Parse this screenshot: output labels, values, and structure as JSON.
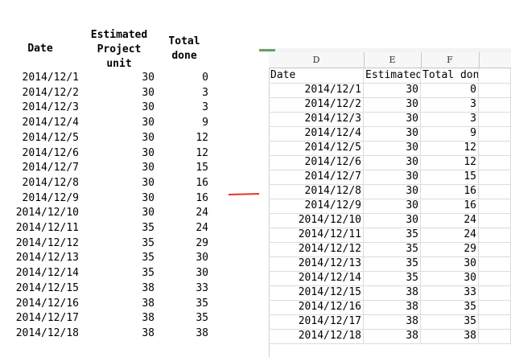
{
  "left_table": {
    "headers": {
      "date": "Date",
      "estimated": "Estimated\nProject\nunit",
      "total": "Total\ndone"
    },
    "rows": [
      {
        "date": "2014/12/1",
        "estimated": "30",
        "total": "0"
      },
      {
        "date": "2014/12/2",
        "estimated": "30",
        "total": "3"
      },
      {
        "date": "2014/12/3",
        "estimated": "30",
        "total": "3"
      },
      {
        "date": "2014/12/4",
        "estimated": "30",
        "total": "9"
      },
      {
        "date": "2014/12/5",
        "estimated": "30",
        "total": "12"
      },
      {
        "date": "2014/12/6",
        "estimated": "30",
        "total": "12"
      },
      {
        "date": "2014/12/7",
        "estimated": "30",
        "total": "15"
      },
      {
        "date": "2014/12/8",
        "estimated": "30",
        "total": "16"
      },
      {
        "date": "2014/12/9",
        "estimated": "30",
        "total": "16"
      },
      {
        "date": "2014/12/10",
        "estimated": "30",
        "total": "24"
      },
      {
        "date": "2014/12/11",
        "estimated": "35",
        "total": "24"
      },
      {
        "date": "2014/12/12",
        "estimated": "35",
        "total": "29"
      },
      {
        "date": "2014/12/13",
        "estimated": "35",
        "total": "30"
      },
      {
        "date": "2014/12/14",
        "estimated": "35",
        "total": "30"
      },
      {
        "date": "2014/12/15",
        "estimated": "38",
        "total": "33"
      },
      {
        "date": "2014/12/16",
        "estimated": "38",
        "total": "35"
      },
      {
        "date": "2014/12/17",
        "estimated": "38",
        "total": "35"
      },
      {
        "date": "2014/12/18",
        "estimated": "38",
        "total": "38"
      }
    ]
  },
  "arrow": {
    "icon": "right-arrow-icon",
    "color": "#e8312a"
  },
  "spreadsheet": {
    "column_headers": [
      "D",
      "E",
      "F"
    ],
    "header_row": {
      "date": "Date",
      "estimated": "Estimated",
      "total": "Total done"
    },
    "rows": [
      {
        "date": "2014/12/1",
        "estimated": "30",
        "total": "0"
      },
      {
        "date": "2014/12/2",
        "estimated": "30",
        "total": "3"
      },
      {
        "date": "2014/12/3",
        "estimated": "30",
        "total": "3"
      },
      {
        "date": "2014/12/4",
        "estimated": "30",
        "total": "9"
      },
      {
        "date": "2014/12/5",
        "estimated": "30",
        "total": "12"
      },
      {
        "date": "2014/12/6",
        "estimated": "30",
        "total": "12"
      },
      {
        "date": "2014/12/7",
        "estimated": "30",
        "total": "15"
      },
      {
        "date": "2014/12/8",
        "estimated": "30",
        "total": "16"
      },
      {
        "date": "2014/12/9",
        "estimated": "30",
        "total": "16"
      },
      {
        "date": "2014/12/10",
        "estimated": "30",
        "total": "24"
      },
      {
        "date": "2014/12/11",
        "estimated": "35",
        "total": "24"
      },
      {
        "date": "2014/12/12",
        "estimated": "35",
        "total": "29"
      },
      {
        "date": "2014/12/13",
        "estimated": "35",
        "total": "30"
      },
      {
        "date": "2014/12/14",
        "estimated": "35",
        "total": "30"
      },
      {
        "date": "2014/12/15",
        "estimated": "38",
        "total": "33"
      },
      {
        "date": "2014/12/16",
        "estimated": "38",
        "total": "35"
      },
      {
        "date": "2014/12/17",
        "estimated": "38",
        "total": "35"
      },
      {
        "date": "2014/12/18",
        "estimated": "38",
        "total": "38"
      }
    ]
  }
}
